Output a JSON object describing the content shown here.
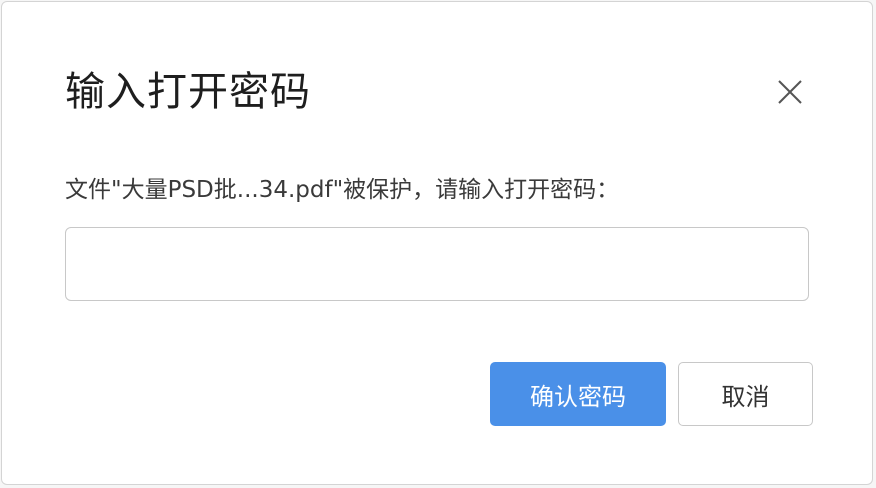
{
  "dialog": {
    "title": "输入打开密码",
    "message": "文件\"大量PSD批...34.pdf\"被保护，请输入打开密码：",
    "password_value": "",
    "close_icon": "close-icon",
    "confirm_label": "确认密码",
    "cancel_label": "取消"
  },
  "colors": {
    "primary": "#4a90e8",
    "title_text": "#1e1e1e",
    "border": "#c8c8c8"
  }
}
